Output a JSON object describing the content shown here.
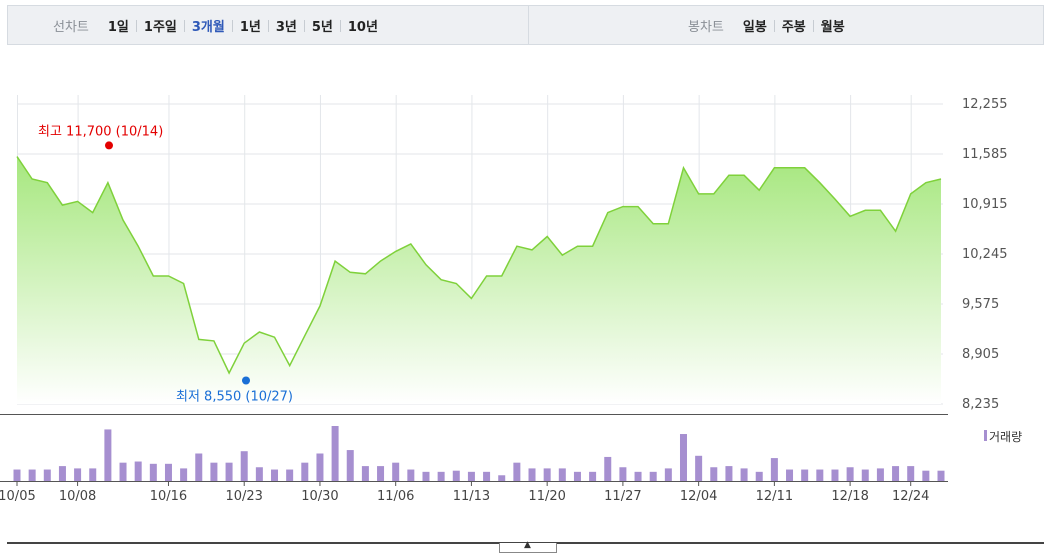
{
  "toolbar": {
    "line_label": "선차트",
    "line_options": [
      "1일",
      "1주일",
      "3개월",
      "1년",
      "3년",
      "5년",
      "10년"
    ],
    "line_active": "3개월",
    "candle_label": "봉차트",
    "candle_options": [
      "일봉",
      "주봉",
      "월봉"
    ]
  },
  "colors": {
    "line": "#7fd13b",
    "fill_top": "#a6e77e",
    "fill_bottom": "#ffffff",
    "volume_bar": "#a68fd0",
    "high_marker": "#e30000",
    "low_marker": "#1a6fd6",
    "grid": "#e3e6ea",
    "accent": "#2f59b8"
  },
  "collapse_icon": "caret-up-icon",
  "chart_data": {
    "type": "area",
    "y_ticks": [
      "12,255",
      "11,585",
      "10,915",
      "10,245",
      "9,575",
      "8,905",
      "8,235"
    ],
    "ylim": [
      8235,
      12255
    ],
    "grid": true,
    "annotations": {
      "high": {
        "label": "최고 11,700 (10/14)",
        "value": 11700
      },
      "low": {
        "label": "최저 8,550 (10/27)",
        "value": 8550
      }
    },
    "price": [
      11550,
      11250,
      11200,
      10900,
      10950,
      10800,
      11200,
      10700,
      10350,
      9950,
      9950,
      9850,
      9100,
      9080,
      8650,
      9050,
      9200,
      9130,
      8750,
      9150,
      9550,
      10150,
      10000,
      9980,
      10150,
      10280,
      10380,
      10100,
      9900,
      9850,
      9650,
      9950,
      9950,
      10350,
      10300,
      10480,
      10230,
      10350,
      10350,
      10800,
      10880,
      10880,
      10650,
      10650,
      11400,
      11050,
      11050,
      11300,
      11300,
      11100,
      11400,
      11400,
      11400,
      11200,
      10980,
      10750,
      10830,
      10830,
      10550,
      11050,
      11200,
      11250
    ],
    "volume_legend": "거래량",
    "volume": [
      1.0,
      1.0,
      1.0,
      1.3,
      1.1,
      1.1,
      4.5,
      1.6,
      1.7,
      1.5,
      1.5,
      1.1,
      2.4,
      1.6,
      1.6,
      2.6,
      1.2,
      1.0,
      1.0,
      1.6,
      2.4,
      4.8,
      2.7,
      1.3,
      1.3,
      1.6,
      1.0,
      0.8,
      0.8,
      0.9,
      0.8,
      0.8,
      0.5,
      1.6,
      1.1,
      1.1,
      1.1,
      0.8,
      0.8,
      2.1,
      1.2,
      0.8,
      0.8,
      1.1,
      4.1,
      2.2,
      1.2,
      1.3,
      1.1,
      0.8,
      2.0,
      1.0,
      1.0,
      1.0,
      1.0,
      1.2,
      1.0,
      1.1,
      1.3,
      1.3,
      0.9,
      0.9
    ],
    "x_tick_labels": [
      "10/05",
      "10/08",
      "10/16",
      "10/23",
      "10/30",
      "11/06",
      "11/13",
      "11/20",
      "11/27",
      "12/04",
      "12/11",
      "12/18",
      "12/24"
    ],
    "x_tick_index": [
      0,
      4,
      10,
      15,
      20,
      25,
      30,
      35,
      40,
      45,
      50,
      55,
      59
    ]
  }
}
